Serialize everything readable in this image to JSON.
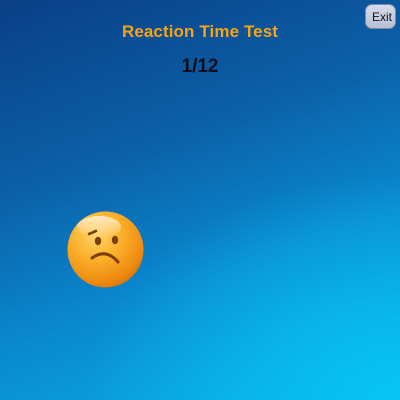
{
  "app": {
    "title": "Reaction Time Test",
    "counter": "1/12"
  },
  "toolbar": {
    "exit_label": "Exit"
  },
  "target": {
    "icon": "sad-face-icon",
    "face_color": "#f7a21b"
  },
  "colors": {
    "title": "#f5a417",
    "counter": "#0d0d1c",
    "background_top": "#0a3f86",
    "background_bottom": "#08c4f5"
  }
}
